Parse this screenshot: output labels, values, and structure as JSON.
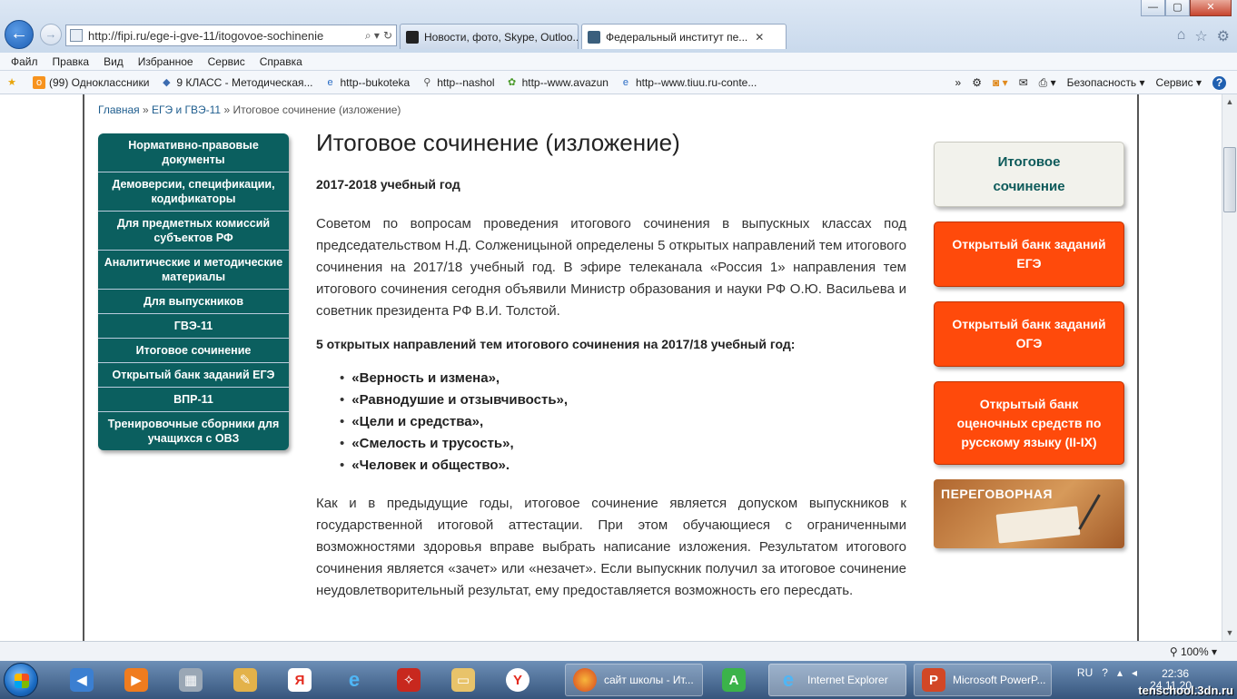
{
  "window": {
    "minimize": "—",
    "maximize": "▢",
    "close": "✕"
  },
  "address_bar": {
    "url": "http://fipi.ru/ege-i-gve-11/itogovoe-sochinenie",
    "search_glyph": "⌕ ▾",
    "refresh_glyph": "↻"
  },
  "tabs": [
    {
      "label": "Новости, фото, Skype, Outloo..."
    },
    {
      "label": "Федеральный институт пе...",
      "close": "✕"
    }
  ],
  "menu": [
    "Файл",
    "Правка",
    "Вид",
    "Избранное",
    "Сервис",
    "Справка"
  ],
  "favorites": [
    "(99) Одноклассники",
    "9 КЛАСС - Методическая...",
    "http--bukoteka",
    "http--nashol",
    "http--www.avazun",
    "http--www.tiuu.ru-conte..."
  ],
  "command_bar": {
    "chevron": "»",
    "security": "Безопасность",
    "service": "Сервис",
    "help": "?"
  },
  "breadcrumb": {
    "home": "Главная",
    "sep1": " » ",
    "section": "ЕГЭ и ГВЭ-11",
    "sep2": " » ",
    "current": "Итоговое сочинение (изложение)"
  },
  "left_nav": [
    "Нормативно-правовые документы",
    "Демоверсии, спецификации, кодификаторы",
    "Для предметных комиссий субъектов РФ",
    "Аналитические и методические материалы",
    "Для выпускников",
    "ГВЭ-11",
    "Итоговое сочинение",
    "Открытый банк заданий ЕГЭ",
    "ВПР-11",
    "Тренировочные сборники для учащихся с ОВЗ"
  ],
  "article": {
    "title": "Итоговое сочинение (изложение)",
    "year": "2017-2018 учебный год",
    "para1": "Советом по вопросам проведения итогового сочинения в выпускных классах под председательством Н.Д. Солженицыной определены 5 открытых направлений тем итогового сочинения на 2017/18 учебный год. В эфире телеканала «Россия 1» направления тем итогового сочинения сегодня объявили Министр образования и науки РФ О.Ю. Васильева и советник президента РФ В.И. Толстой.",
    "subhead": "5 открытых направлений тем итогового сочинения на 2017/18 учебный год:",
    "directions": [
      "«Верность и измена»,",
      "«Равнодушие и отзывчивость»,",
      "«Цели и средства»,",
      "«Смелость и трусость»,",
      "«Человек и общество»."
    ],
    "para2": "Как и в предыдущие годы, итоговое сочинение является допуском выпускников к государственной итоговой аттестации. При этом обучающиеся с ограниченными возможностями здоровья вправе выбрать написание изложения. Результатом итогового сочинения является «зачет» или «незачет». Если выпускник получил за итоговое сочинение неудовлетворительный результат, ему предоставляется возможность его пересдать."
  },
  "sidebar": {
    "essay": "Итоговое сочинение",
    "bank_ege": "Открытый банк заданий ЕГЭ",
    "bank_oge": "Открытый банк заданий ОГЭ",
    "bank_russian": "Открытый банк оценочных средств по русскому языку (II-IX)",
    "banner": "ПЕРЕГОВОРНАЯ"
  },
  "statusbar": {
    "zoom": "100%"
  },
  "taskbar": {
    "tasks": [
      "сайт школы - Ит...",
      "Internet Explorer",
      "Microsoft PowerP..."
    ],
    "lang": "RU",
    "time": "22:36",
    "date": "24.11.20...",
    "watermark": "tenschool.3dn.ru"
  },
  "colors": {
    "nav_teal": "#0b5f5f",
    "cta_orange": "#ff4a0b",
    "link_blue": "#1e5d8e"
  }
}
